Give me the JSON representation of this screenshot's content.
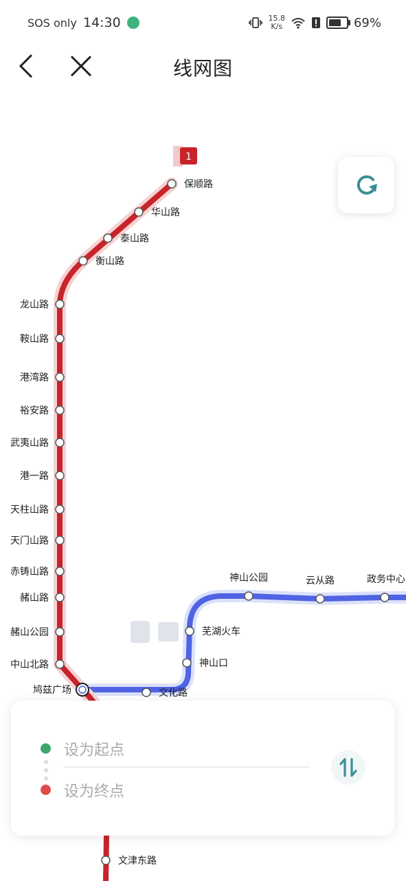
{
  "status_bar": {
    "carrier": "SOS only",
    "time": "14:30",
    "speed_value": "15.8",
    "speed_unit": "K/s",
    "battery": "69%",
    "battery_level": 0.69
  },
  "header": {
    "title": "线网图"
  },
  "lines": {
    "line1_badge": "1"
  },
  "stations": [
    "保顺路",
    "华山路",
    "泰山路",
    "衡山路",
    "龙山路",
    "鞍山路",
    "港湾路",
    "裕安路",
    "武夷山路",
    "港一路",
    "天柱山路",
    "天门山路",
    "赤铸山路",
    "赭山路",
    "赭山公园",
    "中山北路",
    "鸠兹广场",
    "文化路",
    "神山口",
    "芜湖火车",
    "神山公园",
    "云从路",
    "政务中心",
    "文津东路"
  ],
  "panel": {
    "start_label": "设为起点",
    "end_label": "设为终点"
  },
  "colors": {
    "line1": "#c8242b",
    "line2": "#4f63e3",
    "accent": "#3a8f95",
    "start_dot": "#3fa66a",
    "end_dot": "#e04a4a"
  },
  "icons": {
    "back": "chevron-left-icon",
    "close": "close-icon",
    "refresh": "refresh-icon",
    "swap": "swap-icon"
  }
}
